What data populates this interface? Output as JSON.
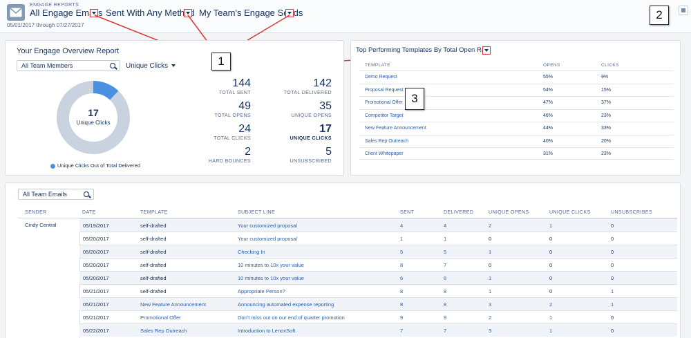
{
  "header": {
    "app_label": "ENGAGE REPORTS",
    "report_type": "All Engage Emails",
    "method": "Sent With Any Method",
    "scope": "My Team's Engage Sends",
    "date_range": "05/01/2017 through 07/27/2017"
  },
  "callouts": {
    "one": "1",
    "two": "2",
    "three": "3"
  },
  "overview": {
    "title": "Your Engage Overview Report",
    "member_filter": "All Team Members",
    "metric_select": "Unique Clicks",
    "donut": {
      "value": "17",
      "label": "Unique Clicks",
      "fraction": 0.12,
      "color_main": "#4a90e2",
      "color_rest": "#c9d2df"
    },
    "legend": "Unique Clicks Out of Total Delivered",
    "stats": {
      "total_sent": {
        "num": "144",
        "label": "TOTAL SENT"
      },
      "total_delivered": {
        "num": "142",
        "label": "TOTAL DELIVERED"
      },
      "total_opens": {
        "num": "49",
        "label": "TOTAL OPENS"
      },
      "unique_opens": {
        "num": "35",
        "label": "UNIQUE OPENS"
      },
      "total_clicks": {
        "num": "24",
        "label": "TOTAL CLICKS"
      },
      "unique_clicks": {
        "num": "17",
        "label": "UNIQUE CLICKS"
      },
      "hard_bounces": {
        "num": "2",
        "label": "HARD BOUNCES"
      },
      "unsubscribed": {
        "num": "5",
        "label": "UNSUBSCRIBED"
      }
    }
  },
  "top_templates": {
    "title": "Top Performing Templates By Total Open Rate",
    "columns": [
      "TEMPLATE",
      "OPENS",
      "CLICKS"
    ],
    "rows": [
      [
        "Demo Request",
        "55%",
        "9%"
      ],
      [
        "Proposal Request",
        "54%",
        "15%"
      ],
      [
        "Promotional Offer",
        "47%",
        "37%"
      ],
      [
        "Competitor Target",
        "46%",
        "23%"
      ],
      [
        "New Feature Announcement",
        "44%",
        "33%"
      ],
      [
        "Sales Rep Outreach",
        "40%",
        "20%"
      ],
      [
        "Client Whitepaper",
        "31%",
        "23%"
      ]
    ]
  },
  "emails": {
    "search": "All Team Emails",
    "columns": [
      "SENDER",
      "DATE",
      "TEMPLATE",
      "SUBJECT LINE",
      "SENT",
      "DELIVERED",
      "UNIQUE OPENS",
      "UNIQUE CLICKS",
      "UNSUBSCRIBES"
    ],
    "sender": "Cindy Central",
    "rows": [
      [
        "05/19/2017",
        "self-drafted",
        "Your customized proposal",
        "4",
        "4",
        "2",
        "1",
        "0"
      ],
      [
        "05/20/2017",
        "self-drafted",
        "Your customized proposal",
        "1",
        "1",
        "0",
        "0",
        "0"
      ],
      [
        "05/20/2017",
        "self-drafted",
        "Checking In",
        "5",
        "5",
        "1",
        "0",
        "0"
      ],
      [
        "05/20/2017",
        "self-drafted",
        "10 minutes to 10x your value",
        "8",
        "7",
        "0",
        "0",
        "0"
      ],
      [
        "05/20/2017",
        "self-drafted",
        "10 minutes to 10x your value",
        "6",
        "6",
        "1",
        "0",
        "0"
      ],
      [
        "05/21/2017",
        "self-drafted",
        "Appropriate Person?",
        "8",
        "8",
        "1",
        "0",
        "1"
      ],
      [
        "05/21/2017",
        "New Feature Announcement",
        "Announcing automated expense reporting",
        "8",
        "8",
        "3",
        "2",
        "1"
      ],
      [
        "05/21/2017",
        "Promotional Offer",
        "Don't miss out on our end of quarter promotion",
        "9",
        "9",
        "2",
        "1",
        "0"
      ],
      [
        "05/22/2017",
        "Sales Rep Outreach",
        "Introduction to LenoxSoft",
        "7",
        "7",
        "3",
        "1",
        "0"
      ]
    ]
  }
}
